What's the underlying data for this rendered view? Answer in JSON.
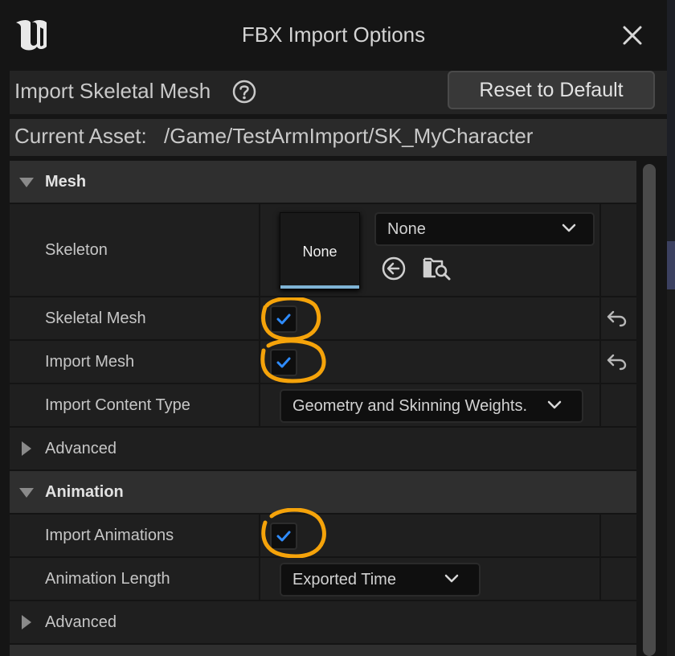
{
  "window": {
    "title": "FBX Import Options"
  },
  "header": {
    "title": "Import Skeletal Mesh",
    "reset_label": "Reset to Default"
  },
  "asset": {
    "label": "Current Asset:",
    "path": "/Game/TestArmImport/SK_MyCharacter"
  },
  "sections": {
    "mesh": {
      "title": "Mesh",
      "skeleton_label": "Skeleton",
      "skeleton_thumb": "None",
      "skeleton_value": "None",
      "skeletal_mesh_label": "Skeletal Mesh",
      "skeletal_mesh_checked": true,
      "import_mesh_label": "Import Mesh",
      "import_mesh_checked": true,
      "content_type_label": "Import Content Type",
      "content_type_value": "Geometry and Skinning Weights.",
      "advanced_label": "Advanced"
    },
    "animation": {
      "title": "Animation",
      "import_animations_label": "Import Animations",
      "import_animations_checked": true,
      "length_label": "Animation Length",
      "length_value": "Exported Time",
      "advanced_label": "Advanced"
    }
  },
  "icons": {
    "logo": "unreal-logo-icon",
    "close": "close-icon",
    "help": "help-icon",
    "use_selected": "use-selected-asset-icon",
    "browse": "browse-asset-icon",
    "reset": "reset-to-default-icon",
    "dropdown": "chevron-down-icon",
    "checkmark": "checkmark-icon"
  },
  "colors": {
    "checkmark": "#2f8cff",
    "annotation": "#f5a30a",
    "background": "#151515",
    "category": "#2f2f2f",
    "property": "#1f1f1f"
  }
}
